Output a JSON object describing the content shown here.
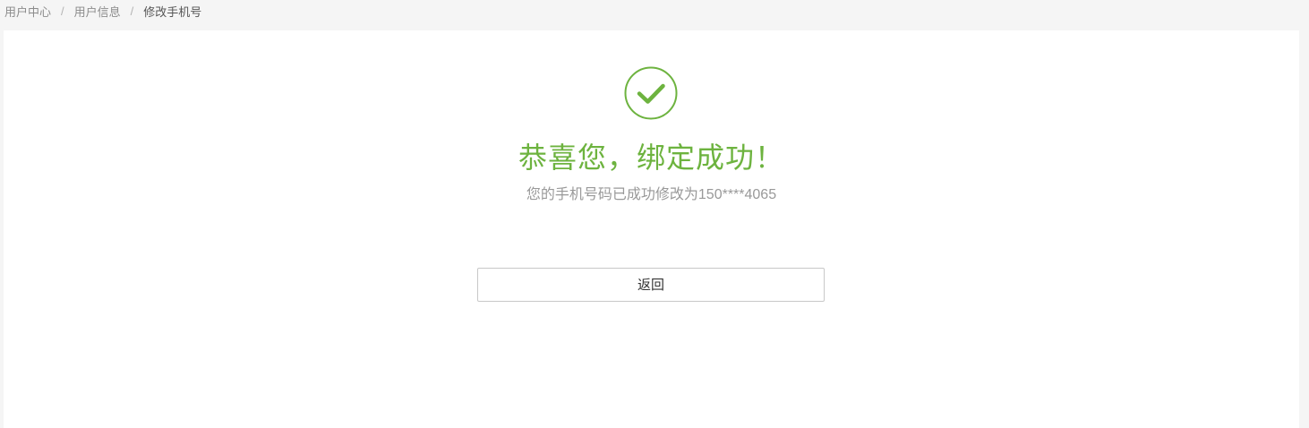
{
  "breadcrumb": {
    "items": [
      {
        "label": "用户中心"
      },
      {
        "label": "用户信息"
      },
      {
        "label": "修改手机号"
      }
    ],
    "separator": "/"
  },
  "result": {
    "icon": "check-circle-icon",
    "title": "恭喜您，绑定成功！",
    "message": "您的手机号码已成功修改为150****4065"
  },
  "actions": {
    "back_label": "返回"
  },
  "colors": {
    "success": "#6db33f",
    "page_background": "#f5f5f5",
    "card_background": "#ffffff",
    "muted_text": "#999999"
  }
}
